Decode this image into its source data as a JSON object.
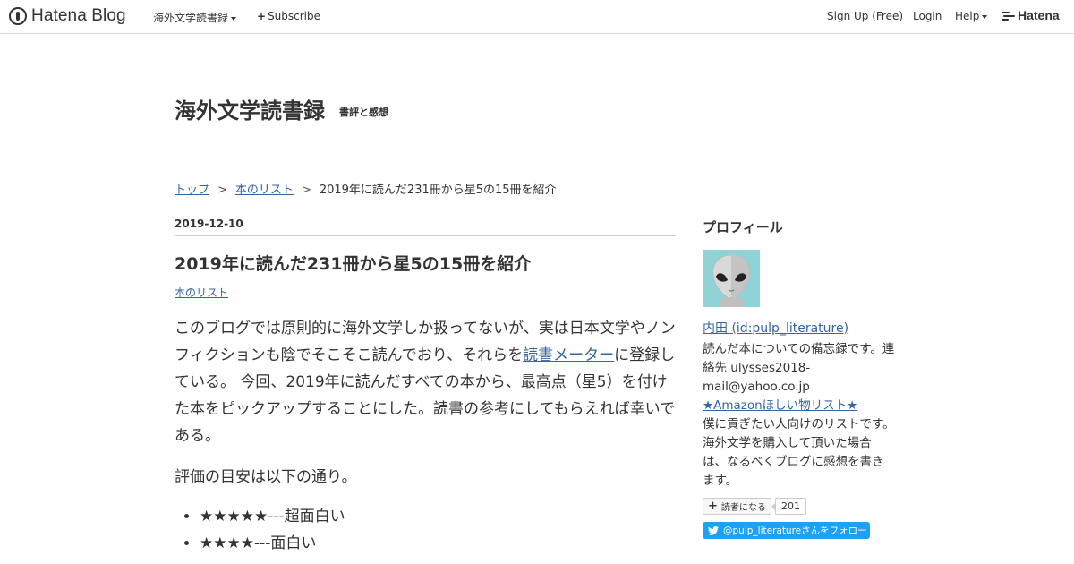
{
  "globalbar": {
    "logo_text": "Hatena Blog",
    "blog_menu": "海外文学読書録",
    "subscribe": "Subscribe",
    "signup": "Sign Up (Free)",
    "login": "Login",
    "help": "Help",
    "hatena": "Hatena"
  },
  "blog": {
    "title": "海外文学読書録",
    "description": "書評と感想"
  },
  "breadcrumb": {
    "top": "トップ",
    "list": "本のリスト",
    "current": "2019年に読んだ231冊から星5の15冊を紹介",
    "sep": ">"
  },
  "entry": {
    "date": "2019-12-10",
    "title": "2019年に読んだ231冊から星5の15冊を紹介",
    "category": "本のリスト",
    "p1_before": "このブログでは原則的に海外文学しか扱ってないが、実は日本文学やノンフィクションも陰でそこそこ読んでおり、それらを",
    "p1_link": "読書メーター",
    "p1_after": "に登録している。 今回、2019年に読んだすべての本から、最高点（星5）を付けた本をピックアップすることにした。読書の参考にしてもらえれば幸いである。",
    "p2": "評価の目安は以下の通り。",
    "ratings": [
      "★★★★★---超面白い",
      "★★★★---面白い"
    ]
  },
  "sidebar": {
    "heading": "プロフィール",
    "name": "内田 (id:pulp_literature)",
    "desc1": "読んだ本についての備忘録です。連絡先 ulysses2018-mail@yahoo.co.jp",
    "amazon_link": "★Amazonほしい物リスト★",
    "desc2": "僕に貢ぎたい人向けのリストです。海外文学を購入して頂いた場合は、なるべくブログに感想を書きます。",
    "subscribe_label": "読者になる",
    "subscriber_count": "201",
    "twitter_follow": "@pulp_literatureさんをフォロー"
  },
  "colors": {
    "link": "#3465a4",
    "twitter": "#1da1f2",
    "avatar_bg": "#8fd3d6"
  }
}
